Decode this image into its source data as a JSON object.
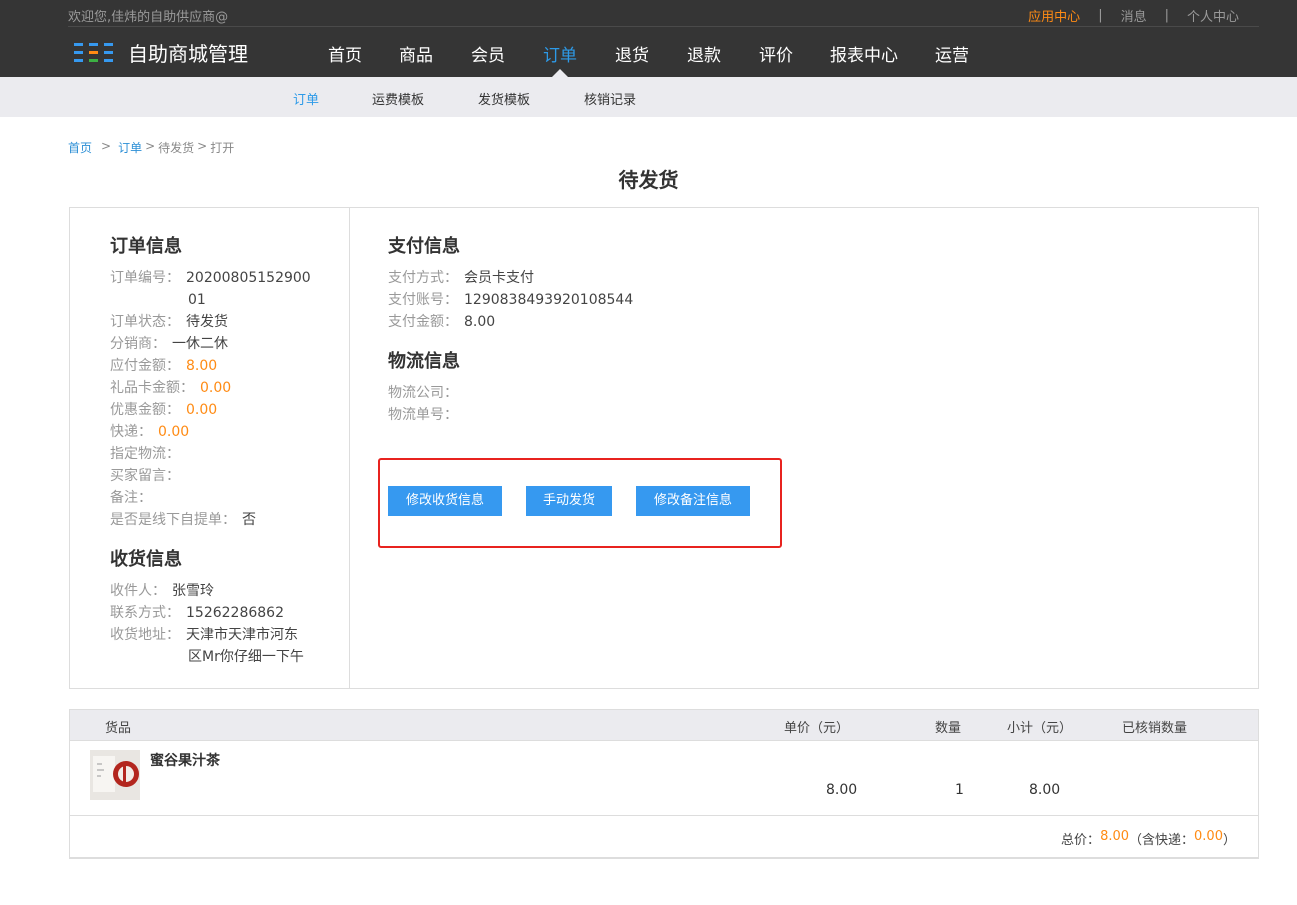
{
  "header": {
    "welcome": "欢迎您,佳炜的自助供应商@",
    "links": [
      "应用中心",
      "消息",
      "个人中心"
    ],
    "separator": "|",
    "app_title": "自助商城管理"
  },
  "nav": {
    "items": [
      "首页",
      "商品",
      "会员",
      "订单",
      "退货",
      "退款",
      "评价",
      "报表中心",
      "运营"
    ],
    "active": "订单"
  },
  "subnav": {
    "items": [
      "订单",
      "运费模板",
      "发货模板",
      "核销记录"
    ],
    "active": "订单"
  },
  "breadcrumb": {
    "items": [
      "首页",
      "订单",
      "待发货",
      "打开"
    ],
    "separator": ">"
  },
  "page_title": "待发货",
  "order_info": {
    "title": "订单信息",
    "order_no_label": "订单编号：",
    "order_no_line1": "20200805152900",
    "order_no_line2": "01",
    "status_label": "订单状态：",
    "status": "待发货",
    "distributor_label": "分销商：",
    "distributor": "一休二休",
    "payable_label": "应付金额：",
    "payable": "8.00",
    "giftcard_label": "礼品卡金额：",
    "giftcard": "0.00",
    "discount_label": "优惠金额：",
    "discount": "0.00",
    "express_label": "快递：",
    "express": "0.00",
    "logistics_label": "指定物流：",
    "buyer_msg_label": "买家留言：",
    "remark_label": "备注：",
    "offline_pickup_label": "是否是线下自提单：",
    "offline_pickup": "否"
  },
  "receiver_info": {
    "title": "收货信息",
    "name_label": "收件人：",
    "name": "张雪玲",
    "phone_label": "联系方式：",
    "phone": "15262286862",
    "address_label": "收货地址：",
    "address_line1": "天津市天津市河东",
    "address_line2": "区Mr你仔细一下午"
  },
  "payment_info": {
    "title": "支付信息",
    "method_label": "支付方式：",
    "method": "会员卡支付",
    "account_label": "支付账号：",
    "account": "1290838493920108544",
    "amount_label": "支付金额：",
    "amount": "8.00"
  },
  "logistics_info": {
    "title": "物流信息",
    "company_label": "物流公司：",
    "tracking_label": "物流单号："
  },
  "actions": {
    "edit_receiver": "修改收货信息",
    "manual_ship": "手动发货",
    "edit_remark": "修改备注信息"
  },
  "goods_table": {
    "headers": [
      "货品",
      "单价（元）",
      "数量",
      "小计（元）",
      "已核销数量"
    ],
    "rows": [
      {
        "name": "蜜谷果汁茶",
        "price": "8.00",
        "qty": "1",
        "subtotal": "8.00",
        "verified": ""
      }
    ],
    "total_label": "总价：",
    "total": "8.00",
    "express_open": "（含快递：",
    "express": "0.00",
    "express_close": "）"
  },
  "colors": {
    "header_bg": "#353535",
    "accent_blue": "#2d9ae8",
    "button_blue": "#3699f0",
    "orange": "#ff8b14",
    "highlight_red": "#e8231f",
    "subnav_bg": "#ebebef"
  }
}
